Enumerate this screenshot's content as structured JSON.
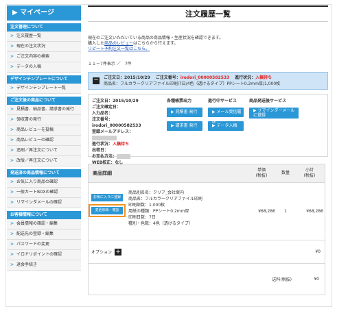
{
  "sidebar": {
    "title": "マイページ",
    "sections": [
      {
        "head": "注文管理について",
        "items": [
          "注文履歴一覧",
          "現在の注文状況",
          "ご注文内容の検索",
          "データの入稿"
        ]
      },
      {
        "head": "デザインテンプレートについて",
        "items": [
          "デザインテンプレート一覧"
        ]
      },
      {
        "head": "ご注文後の商品について",
        "items": [
          "見積書、納品書、請求書の発行",
          "領収書の発行",
          "商品レビューを投稿",
          "商品レビューの確認",
          "追刷／再注文について",
          "改版／再注文について"
        ]
      },
      {
        "head": "発送済の商品情報について",
        "items": [
          "お気に入り商品の確認",
          "一般カートBOXの確認",
          "リマインダメールの確認"
        ]
      },
      {
        "head": "お客様情報について",
        "items": [
          "会員情報の確認・編集",
          "配送先の登録・編集",
          "パスワードの変更",
          "イロドリポイントの確認",
          "退会手続き"
        ]
      }
    ]
  },
  "main": {
    "title": "注文履歴一覧",
    "intro_line1": "現在のご注文いただいている商品の商品情報・生産状況を確認できます。",
    "intro_line2_pre": "購入した",
    "intro_line2_link": "商品のレビュー",
    "intro_line2_post": "はこちらから行えます。",
    "repeat_link": "リピート予約注文一覧はこちら。",
    "count": "１１－7件表示 ／　7件"
  },
  "order": {
    "date_label": "ご注文日：2015/10/29",
    "number_label": "ご注文番号：",
    "number": "irodori_00000582533",
    "status_label": "進行状況：",
    "status": "入稿待ち",
    "product_line": "商品名：フルカラークリアファイル印刷/7日/4色（透けるタイプ）PPシート0.2mm厚/1,000枚"
  },
  "detail": {
    "info": [
      "ご注文日：2015/10/29",
      "ご注文確定日：",
      "入力品名：",
      "注文番号：irodori_00000582533",
      "登録メールアドレス：",
      "進行状況：",
      "出荷日：",
      "お支払方法：",
      "WEB校正：なし"
    ],
    "status_value": "入稿待ち",
    "col2_head": "各種帳票出力",
    "btn_quote": "見積書 発行",
    "btn_invoice": "請求書 発行",
    "col3_head": "進行中サービス",
    "btn_mail": "メール受信履歴",
    "btn_data": "データ入稿",
    "col4_head": "商品発送後サービス",
    "btn_reminder": "リマインダーメールに登録"
  },
  "table": {
    "head_product": "商品詳細",
    "head_price": "単価\n(税抜)",
    "head_qty": "数量",
    "head_subtotal": "小計\n(税抜)",
    "btn_fav": "お気に入りに登録",
    "btn_change": "変更依頼・確認",
    "desc": [
      "商品別名名：クリア_会社案内",
      "商品名：フルカラークリアファイル印刷",
      "印刷部数：1,000枚",
      "用紙の種類：PPシート0.2mm厚",
      "印刷日数：7日",
      "種別・色数：4色（透けるタイプ）"
    ],
    "price": "¥68,286",
    "qty": "1",
    "subtotal": "¥68,286",
    "option_label": "オプション",
    "option_value": "¥0",
    "ship_label": "送料(税抜)",
    "ship_value": "¥0"
  }
}
